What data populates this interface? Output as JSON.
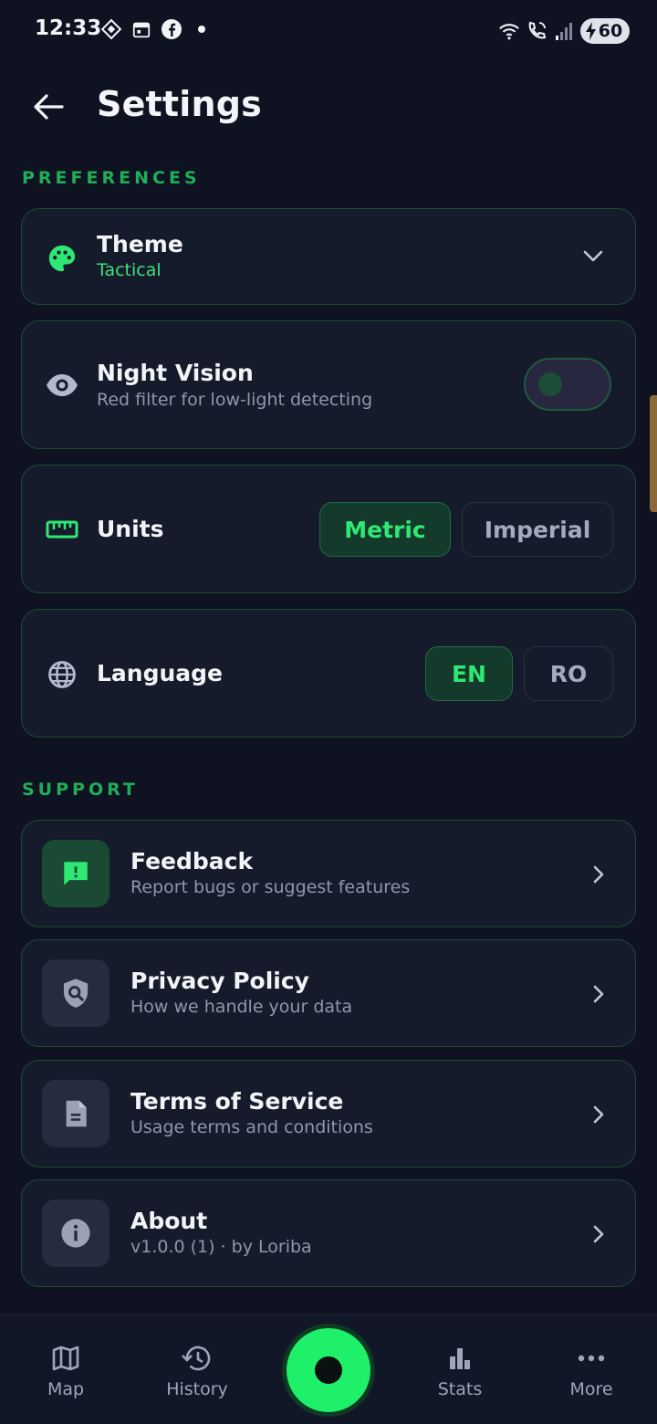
{
  "status_bar": {
    "time": "12:33",
    "battery": "60"
  },
  "header": {
    "title": "Settings"
  },
  "preferences": {
    "section_label": "PREFERENCES",
    "theme": {
      "title": "Theme",
      "value": "Tactical"
    },
    "night_vision": {
      "title": "Night Vision",
      "subtitle": "Red filter for low-light detecting",
      "enabled": false
    },
    "units": {
      "title": "Units",
      "options": [
        "Metric",
        "Imperial"
      ],
      "selected": "Metric"
    },
    "language": {
      "title": "Language",
      "options": [
        "EN",
        "RO"
      ],
      "selected": "EN"
    }
  },
  "support": {
    "section_label": "SUPPORT",
    "items": [
      {
        "title": "Feedback",
        "subtitle": "Report bugs or suggest features",
        "icon": "feedback-icon"
      },
      {
        "title": "Privacy Policy",
        "subtitle": "How we handle your data",
        "icon": "privacy-shield-icon"
      },
      {
        "title": "Terms of Service",
        "subtitle": "Usage terms and conditions",
        "icon": "document-icon"
      },
      {
        "title": "About",
        "subtitle": "v1.0.0 (1) · by Loriba",
        "icon": "info-icon"
      }
    ]
  },
  "bottom_nav": {
    "items": [
      {
        "label": "Map",
        "icon": "map-icon"
      },
      {
        "label": "History",
        "icon": "history-icon"
      },
      {
        "label": "Stats",
        "icon": "stats-icon"
      },
      {
        "label": "More",
        "icon": "more-icon"
      }
    ]
  },
  "colors": {
    "accent": "#1ff06a",
    "background": "#0e1221",
    "card": "#151b2b",
    "section_label": "#1fae57"
  }
}
